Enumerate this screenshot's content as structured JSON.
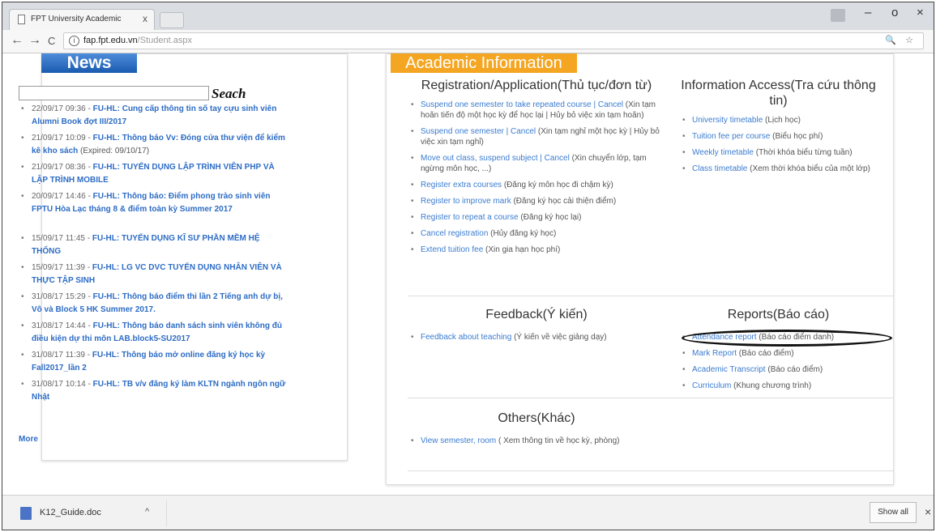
{
  "browser": {
    "tab_title": "FPT University Academic",
    "tab_close": "x",
    "url_host": "fap.fpt.edu.vn",
    "url_path": "/Student.aspx",
    "nav_back": "←",
    "nav_forward": "→",
    "nav_reload": "C",
    "window_minimize": "–",
    "window_maximize": "o",
    "window_close": "×"
  },
  "news": {
    "title": "News",
    "search_label": "Seach",
    "more": "More",
    "items": [
      {
        "time": "22/09/17 09:36 - ",
        "link": "FU-HL: Cung cấp thông tin số tay cựu sinh viên Alumni Book đợt III/2017",
        "extra": ""
      },
      {
        "time": "21/09/17 10:09 - ",
        "link": "FU-HL: Thông báo Vv: Đóng cửa thư viện để kiểm kê kho sách",
        "extra": " (Expired: 09/10/17)"
      },
      {
        "time": "21/09/17 08:36 - ",
        "link": "FU-HL: TUYỂN DỤNG LẬP TRÌNH VIÊN PHP VÀ LẬP TRÌNH MOBILE",
        "extra": ""
      },
      {
        "time": "20/09/17 14:46 - ",
        "link": "FU-HL: Thông báo: Điểm phong trào sinh viên FPTU Hòa Lạc tháng 8 & điểm toàn kỳ Summer 2017",
        "extra": ""
      },
      {
        "time": "15/09/17 11:45 - ",
        "link": "FU-HL: TUYỂN DỤNG KĨ SƯ PHẦN MỀM HỆ THỐNG",
        "extra": ""
      },
      {
        "time": "15/09/17 11:39 - ",
        "link": "FU-HL: LG VC DVC TUYỂN DỤNG NHÂN VIÊN VÀ THỰC TẬP SINH",
        "extra": ""
      },
      {
        "time": "31/08/17 15:29 - ",
        "link": "FU-HL: Thông báo điểm thi lần 2 Tiếng anh dự bị, Vô và Block 5 HK Summer 2017.",
        "extra": ""
      },
      {
        "time": "31/08/17 14:44 - ",
        "link": "FU-HL: Thông báo danh sách sinh viên không đủ điều kiện dự thi môn LAB.block5-SU2017",
        "extra": ""
      },
      {
        "time": "31/08/17 11:39 - ",
        "link": "FU-HL: Thông báo mở online đăng ký học kỳ Fall2017_lần 2",
        "extra": ""
      },
      {
        "time": "31/08/17 10:14 - ",
        "link": "FU-HL: TB v/v đăng ký làm KLTN ngành ngôn ngữ Nhật",
        "extra": ""
      }
    ]
  },
  "academic": {
    "title": "Academic Information",
    "registration": {
      "title": "Registration/Application(Thủ tục/đơn từ)",
      "items": [
        {
          "link": "Suspend one semester to take repeated course | Cancel",
          "note": " (Xin tạm hoãn tiến độ một học kỳ để học lại | Hủy bỏ việc xin tạm hoãn)"
        },
        {
          "link": "Suspend one semester | Cancel",
          "note": " (Xin tạm nghỉ một học kỳ | Hủy bỏ việc xin tạm nghỉ)"
        },
        {
          "link": "Move out class, suspend subject | Cancel",
          "note": " (Xin chuyển lớp, tạm ngừng môn học, ...)"
        },
        {
          "link": "Register extra courses",
          "note": " (Đăng ký môn học đi chậm kỳ)"
        },
        {
          "link": "Register to improve mark",
          "note": " (Đăng ký học cải thiện điểm)"
        },
        {
          "link": "Register to repeat a course",
          "note": " (Đăng ký học lại)"
        },
        {
          "link": "Cancel registration",
          "note": " (Hủy đăng ký học)"
        },
        {
          "link": "Extend tuition fee",
          "note": " (Xin gia hạn học phí)"
        }
      ]
    },
    "information": {
      "title": "Information Access(Tra cứu thông tin)",
      "items": [
        {
          "link": "University timetable",
          "note": " (Lịch học)"
        },
        {
          "link": "Tuition fee per course",
          "note": " (Biểu học phí)"
        },
        {
          "link": "Weekly timetable",
          "note": " (Thời khóa biểu từng tuần)"
        },
        {
          "link": "Class timetable",
          "note": " (Xem thời khóa biểu của một lớp)"
        }
      ]
    },
    "feedback": {
      "title": "Feedback(Ý kiến)",
      "items": [
        {
          "link": "Feedback about teaching",
          "note": " (Ý kiến về việc giảng dạy)"
        }
      ]
    },
    "reports": {
      "title": "Reports(Báo cáo)",
      "items": [
        {
          "link": "Attendance report",
          "note": " (Báo cáo điểm danh)"
        },
        {
          "link": "Mark Report",
          "note": " (Báo cáo điểm)"
        },
        {
          "link": "Academic Transcript",
          "note": " (Báo cáo điểm)"
        },
        {
          "link": "Curriculum",
          "note": " (Khung chương trình)"
        }
      ]
    },
    "others": {
      "title": "Others(Khác)",
      "items": [
        {
          "link": "View semester, room",
          "note": " ( Xem thông tin về học kỳ, phòng)"
        }
      ]
    }
  },
  "downloads": {
    "file_name": "K12_Guide.doc",
    "caret": "^",
    "show_all": "Show all",
    "close": "×"
  }
}
